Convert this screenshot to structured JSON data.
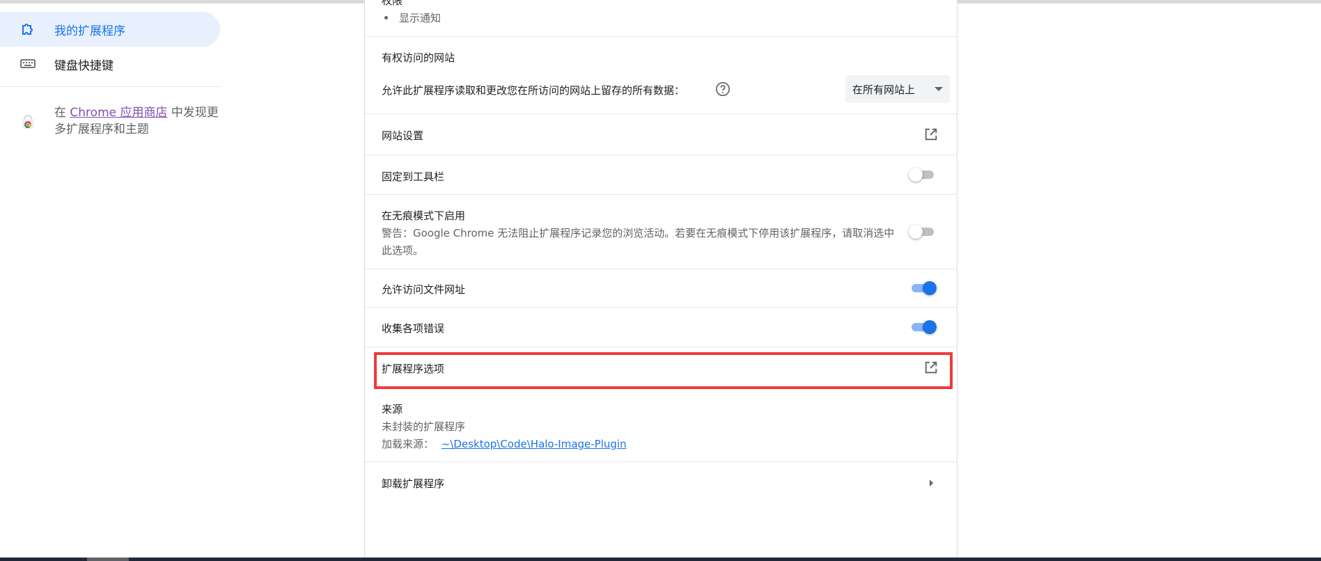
{
  "sidebar": {
    "items": [
      {
        "label": "我的扩展程序",
        "icon": "extension-icon",
        "active": true
      },
      {
        "label": "键盘快捷键",
        "icon": "keyboard-icon",
        "active": false
      }
    ],
    "store_prefix": "在 ",
    "store_link": "Chrome 应用商店",
    "store_suffix": " 中发现更多扩展程序和主题"
  },
  "details": {
    "partial_heading": "权限",
    "permissions": [
      "显示通知"
    ],
    "site_access": {
      "title": "有权访问的网站",
      "description": "允许此扩展程序读取和更改您在所访问的网站上留存的所有数据：",
      "select_value": "在所有网站上"
    },
    "site_settings": "网站设置",
    "pin_toolbar": {
      "label": "固定到工具栏",
      "enabled": false
    },
    "incognito": {
      "label": "在无痕模式下启用",
      "warning": "警告：Google Chrome 无法阻止扩展程序记录您的浏览活动。若要在无痕模式下停用该扩展程序，请取消选中此选项。",
      "enabled": false
    },
    "file_urls": {
      "label": "允许访问文件网址",
      "enabled": true
    },
    "collect_errors": {
      "label": "收集各项错误",
      "enabled": true
    },
    "extension_options": "扩展程序选项",
    "source": {
      "title": "来源",
      "type": "未封装的扩展程序",
      "load_label": "加载来源：",
      "load_path": "~\\Desktop\\Code\\Halo-Image-Plugin"
    },
    "uninstall": "卸载扩展程序"
  },
  "colors": {
    "accent": "#1a73e8",
    "highlight": "#ef3b3b",
    "active_nav_bg": "#e8f0fe"
  }
}
